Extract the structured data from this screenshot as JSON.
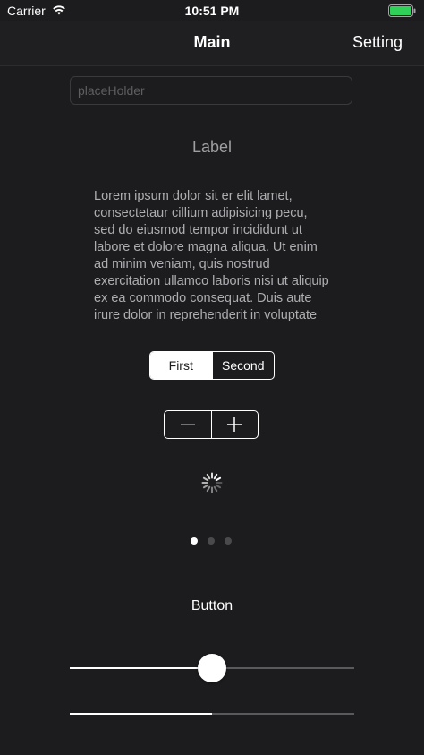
{
  "status_bar": {
    "carrier": "Carrier",
    "time": "10:51 PM",
    "battery_color": "#30d158"
  },
  "nav": {
    "title": "Main",
    "right_button": "Setting"
  },
  "text_field": {
    "value": "",
    "placeholder": "placeHolder"
  },
  "label": "Label",
  "text_view": "Lorem ipsum dolor sit er elit lamet, consectetaur cillium adipisicing pecu, sed do eiusmod tempor incididunt ut labore et dolore magna aliqua. Ut enim ad minim veniam, quis nostrud exercitation ullamco laboris nisi ut aliquip ex ea commodo consequat. Duis aute irure dolor in reprehenderit in voluptate velit esse cillum dolore eu fugiat nulla pariatur.",
  "segmented_control": {
    "segments": [
      "First",
      "Second"
    ],
    "selected_index": 0
  },
  "stepper": {
    "minus_icon": "minus-icon",
    "plus_icon": "plus-icon"
  },
  "page_control": {
    "pages": 3,
    "current_page": 0
  },
  "button": "Button",
  "slider": {
    "value": 0.5
  },
  "progress": {
    "value": 0.5
  }
}
